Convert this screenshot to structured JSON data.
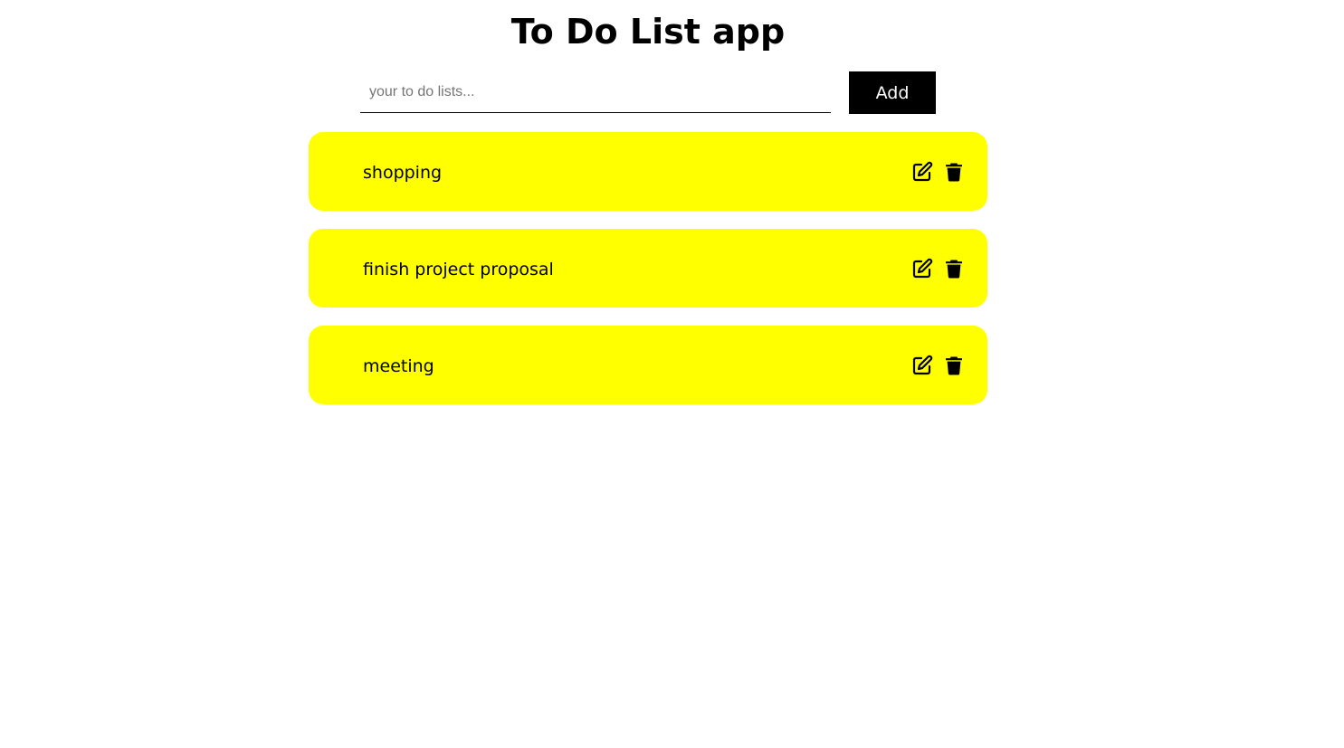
{
  "app": {
    "title": "To Do List app"
  },
  "form": {
    "input_value": "",
    "input_placeholder": "your to do lists...",
    "add_label": "Add"
  },
  "todos": [
    {
      "text": "shopping",
      "edit_icon": "edit-icon",
      "delete_icon": "trash-icon"
    },
    {
      "text": "finish project proposal",
      "edit_icon": "edit-icon",
      "delete_icon": "trash-icon"
    },
    {
      "text": "meeting",
      "edit_icon": "edit-icon",
      "delete_icon": "trash-icon"
    }
  ],
  "colors": {
    "item_background": "#ffff00",
    "button_background": "#000000",
    "button_text": "#ffffff",
    "text": "#000000"
  }
}
